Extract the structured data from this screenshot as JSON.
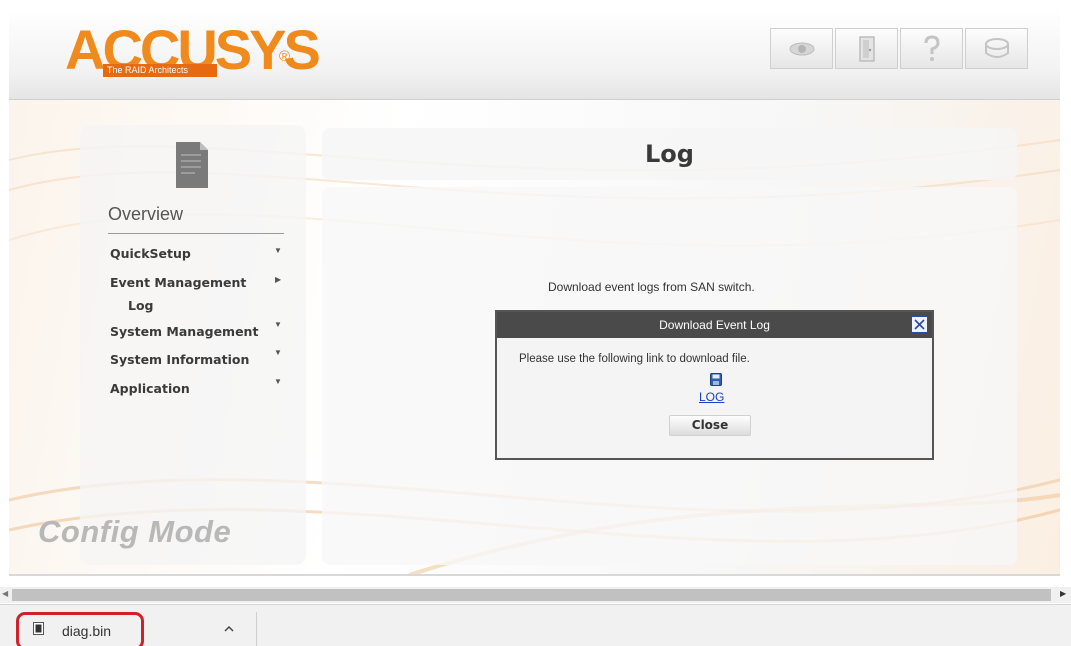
{
  "brand": {
    "logo_text": "ACCUSYS",
    "tagline": "The RAID Architects",
    "registered": "®",
    "color": "#f08a1c"
  },
  "toolbar": {
    "buttons": [
      {
        "icon": "eye-icon"
      },
      {
        "icon": "door-icon"
      },
      {
        "icon": "help-icon"
      },
      {
        "icon": "disk-icon"
      }
    ]
  },
  "sidebar": {
    "heading": "Overview",
    "items": [
      {
        "label": "QuickSetup",
        "arrow": "▼"
      },
      {
        "label": "Event Management",
        "arrow": "▶"
      },
      {
        "label": "Log",
        "arrow": ""
      },
      {
        "label": "System Management",
        "arrow": "▼"
      },
      {
        "label": "System Information",
        "arrow": "▼"
      },
      {
        "label": "Application",
        "arrow": "▼"
      }
    ],
    "mode_label": "Config Mode"
  },
  "main": {
    "title": "Log",
    "description": "Download event logs from SAN switch."
  },
  "dialog": {
    "title": "Download Event Log",
    "message": "Please use the following link to download file.",
    "link_label": "LOG",
    "close_label": "Close"
  },
  "downloads": {
    "file_name": "diag.bin",
    "chevron": "^"
  },
  "colors": {
    "highlight": "#d0202a",
    "dialog_titlebar": "#4a4a4a",
    "link": "#1a3ec7"
  }
}
